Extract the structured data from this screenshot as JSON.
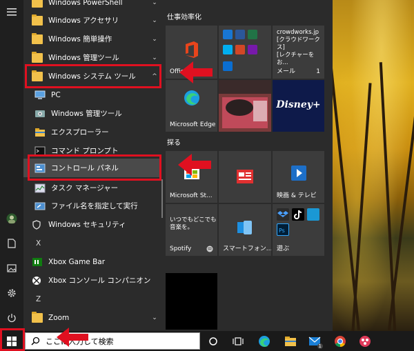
{
  "app_list": {
    "items": [
      {
        "label": "Windows PowerShell",
        "type": "folder",
        "chevron": "⌄"
      },
      {
        "label": "Windows アクセサリ",
        "type": "folder",
        "chevron": "⌄"
      },
      {
        "label": "Windows 簡単操作",
        "type": "folder",
        "chevron": "⌄"
      },
      {
        "label": "Windows 管理ツール",
        "type": "folder",
        "chevron": "⌄"
      },
      {
        "label": "Windows システム ツール",
        "type": "folder",
        "chevron": "^"
      },
      {
        "label": "PC",
        "type": "sub"
      },
      {
        "label": "Windows 管理ツール",
        "type": "sub"
      },
      {
        "label": "エクスプローラー",
        "type": "sub"
      },
      {
        "label": "コマンド プロンプト",
        "type": "sub"
      },
      {
        "label": "コントロール パネル",
        "type": "sub"
      },
      {
        "label": "タスク マネージャー",
        "type": "sub"
      },
      {
        "label": "ファイル名を指定して実行",
        "type": "sub"
      },
      {
        "label": "Windows セキュリティ",
        "type": "app"
      },
      {
        "label": "X",
        "type": "letter"
      },
      {
        "label": "Xbox Game Bar",
        "type": "app"
      },
      {
        "label": "Xbox コンソール コンパニオン",
        "type": "app"
      },
      {
        "label": "Z",
        "type": "letter"
      },
      {
        "label": "Zoom",
        "type": "folder",
        "chevron": "⌄"
      }
    ]
  },
  "tiles": {
    "group1_title": "仕事効率化",
    "group2_title": "探る",
    "office_label": "Office",
    "mail_header1": "crowdworks.jp",
    "mail_header2": "[クラウドワークス]",
    "mail_header3": "[レクチャーをお...",
    "mail_label": "メール",
    "mail_count": "1",
    "edge_label": "Microsoft Edge",
    "disney_label": "Disney+",
    "store_label": "Microsoft St...",
    "movies_label": "映画 & テレビ",
    "spotify_text1": "いつでもどこでも",
    "spotify_text2": "音楽を。",
    "spotify_label": "Spotify",
    "phone_label": "スマートフォン...",
    "play_label": "遊ぶ"
  },
  "taskbar": {
    "search_placeholder": "ここに入力して検索",
    "mail_badge": "1"
  },
  "colors": {
    "annotation_red": "#e01020",
    "folder_yellow": "#f2c14b",
    "menu_bg": "#2b2b2b"
  }
}
